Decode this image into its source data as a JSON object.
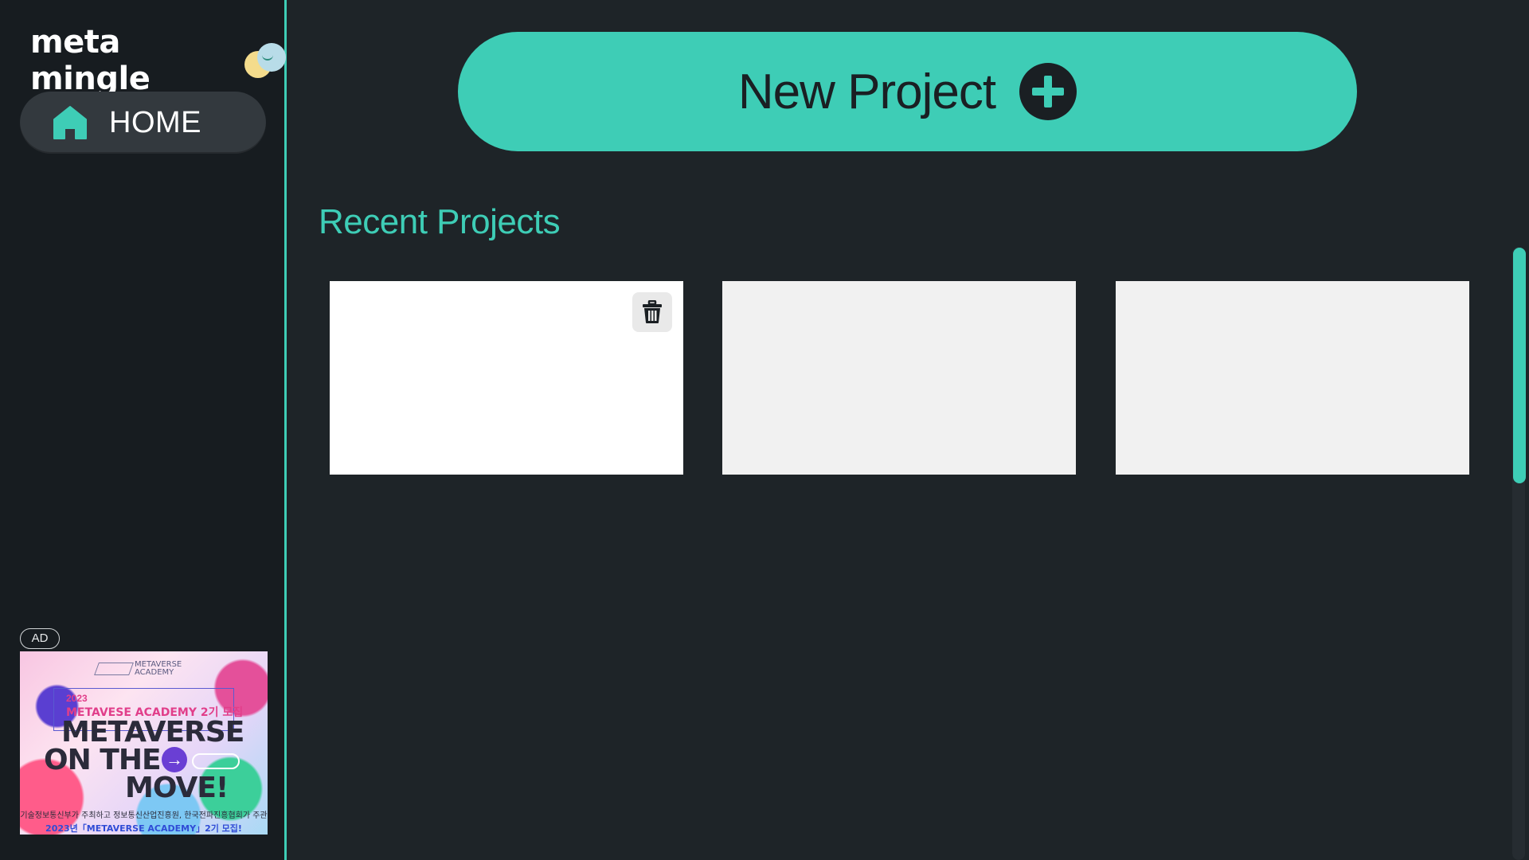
{
  "app": {
    "logo_text": "meta mingle",
    "brand_color": "#3ecdb6"
  },
  "sidebar": {
    "home": {
      "label": "HOME",
      "icon": "home-icon"
    }
  },
  "ad": {
    "badge": "AD",
    "logo_line1": "METAVERSE",
    "logo_line2": "ACADEMY",
    "year": "2023",
    "subtitle": "METAVESE ACADEMY 2기 모집",
    "line1": "METAVERSE",
    "line2": "ON THE",
    "line3": "MOVE!",
    "footer": "기술정보통신부가 주최하고 정보통신산업진흥원, 한국전파진흥협회가 주관",
    "footer2": "2023년「METAVERSE ACADEMY」2기 모집!"
  },
  "main": {
    "new_project_label": "New Project",
    "new_project_icon": "plus-circle-icon",
    "recent_title": "Recent Projects",
    "projects": [
      {
        "id": 1,
        "thumbnail_color": "#ffffff",
        "has_delete": true,
        "delete_icon": "trash-icon"
      },
      {
        "id": 2,
        "thumbnail_color": "#f1f1f1",
        "has_delete": false
      },
      {
        "id": 3,
        "thumbnail_color": "#f1f1f1",
        "has_delete": false
      }
    ]
  }
}
